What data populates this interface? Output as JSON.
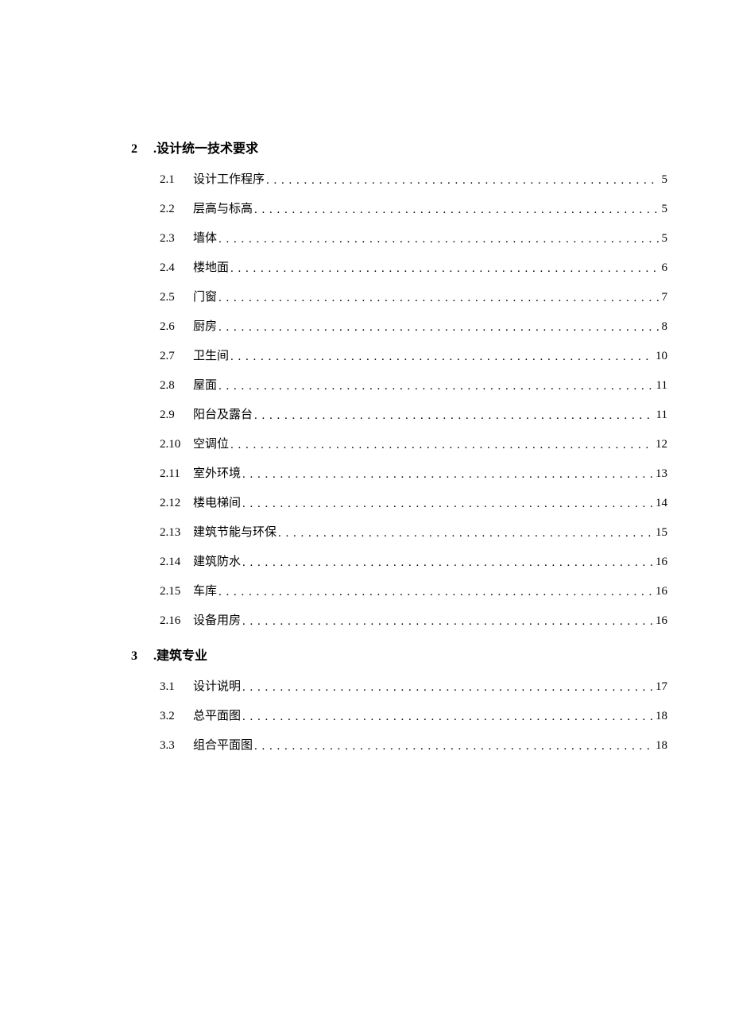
{
  "sections": [
    {
      "number": "2",
      "prefix": ".",
      "title": "设计统一技术要求",
      "entries": [
        {
          "num": "2.1",
          "title": "设计工作程序",
          "page": "5"
        },
        {
          "num": "2.2",
          "title": "层高与标高",
          "page": "5"
        },
        {
          "num": "2.3",
          "title": "墙体",
          "page": "5"
        },
        {
          "num": "2.4",
          "title": "楼地面",
          "page": "6"
        },
        {
          "num": "2.5",
          "title": "门窗",
          "page": "7"
        },
        {
          "num": "2.6",
          "title": "厨房",
          "page": "8"
        },
        {
          "num": "2.7",
          "title": "卫生间",
          "page": "10"
        },
        {
          "num": "2.8",
          "title": "屋面",
          "page": "11"
        },
        {
          "num": "2.9",
          "title": "阳台及露台",
          "page": "11"
        },
        {
          "num": "2.10",
          "title": "空调位",
          "page": "12"
        },
        {
          "num": "2.11",
          "title": "室外环境",
          "page": "13"
        },
        {
          "num": "2.12",
          "title": "楼电梯间",
          "page": "14"
        },
        {
          "num": "2.13",
          "title": "建筑节能与环保",
          "page": "15"
        },
        {
          "num": "2.14",
          "title": "建筑防水",
          "page": "16"
        },
        {
          "num": "2.15",
          "title": "车库",
          "page": "16"
        },
        {
          "num": "2.16",
          "title": "设备用房",
          "page": "16"
        }
      ]
    },
    {
      "number": "3",
      "prefix": ".",
      "title": "建筑专业",
      "entries": [
        {
          "num": "3.1",
          "title": "设计说明",
          "page": "17"
        },
        {
          "num": "3.2",
          "title": "总平面图",
          "page": "18"
        },
        {
          "num": "3.3",
          "title": "组合平面图",
          "page": "18"
        }
      ]
    }
  ]
}
